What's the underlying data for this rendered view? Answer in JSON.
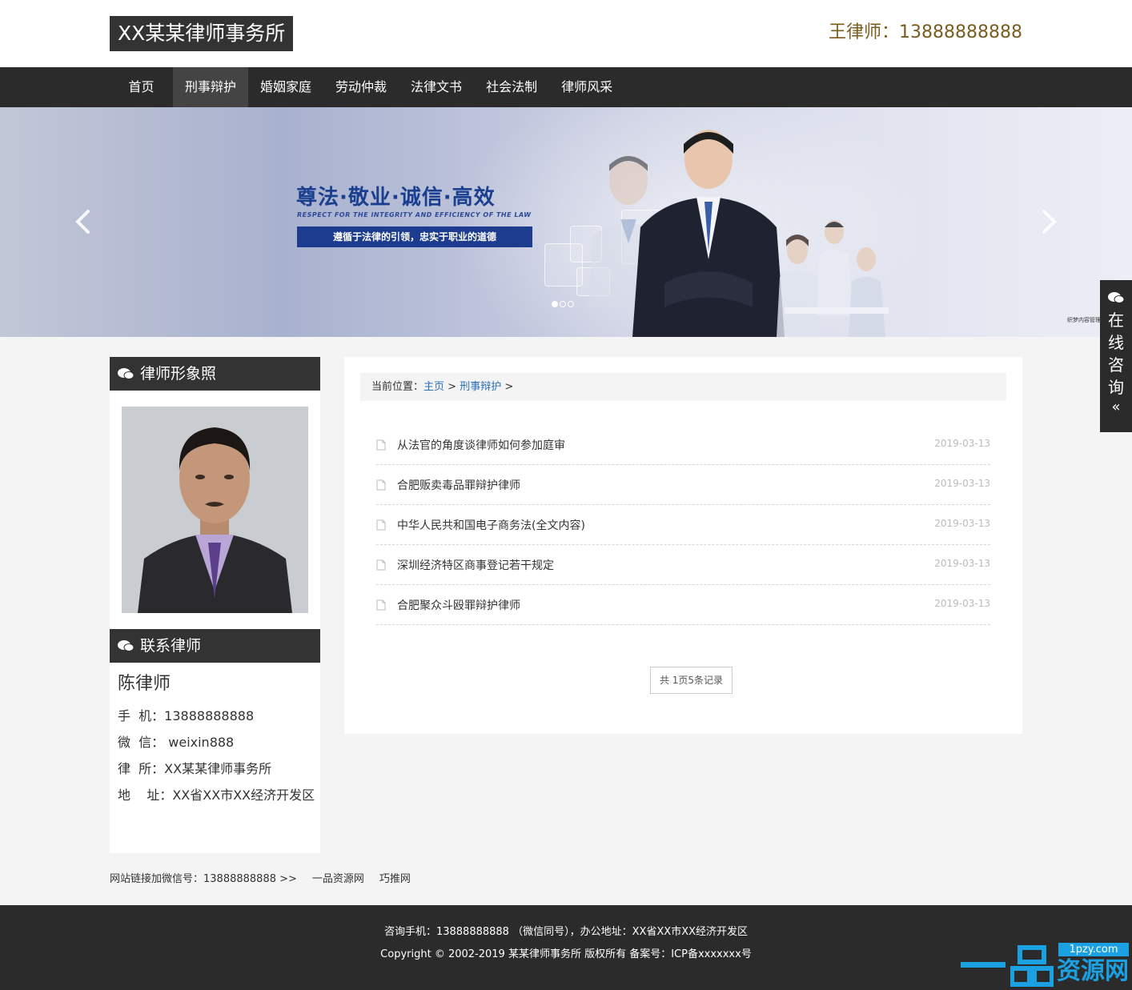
{
  "header": {
    "logo": "XX某某律师事务所",
    "hotline": "王律师：13888888888"
  },
  "nav": {
    "items": [
      "首页",
      "刑事辩护",
      "婚姻家庭",
      "劳动仲裁",
      "法律文书",
      "社会法制",
      "律师风采"
    ],
    "active_index": 1
  },
  "banner": {
    "slogan": "尊法·敬业·诚信·高效",
    "slogan_en": "RESPECT FOR THE INTEGRITY AND EFFICIENCY OF THE LAW",
    "slogan_bar": "遵循于法律的引领，忠实于职业的道德",
    "prev_icon": "‹",
    "next_icon": "›",
    "slide_count": 3,
    "active_slide": 1,
    "corner_text": "织梦内容管理 DEDECMS"
  },
  "consult": {
    "label": "在线咨询",
    "chevron": "«"
  },
  "sidebar": {
    "photo_title": "律师形象照",
    "contact_title": "联系律师",
    "name": "陈律师",
    "phone": "手  机：13888888888",
    "wechat": "微  信： weixin888",
    "firm": "律  所：XX某某律师事务所",
    "address": "地    址：XX省XX市XX经济开发区"
  },
  "main": {
    "crumb_prefix": "当前位置：",
    "crumb_home": "主页",
    "crumb_sep": ">",
    "crumb_cat": "刑事辩护",
    "crumb_end": ">",
    "articles": [
      {
        "title": "从法官的角度谈律师如何参加庭审",
        "date": "2019-03-13"
      },
      {
        "title": "合肥贩卖毒品罪辩护律师",
        "date": "2019-03-13"
      },
      {
        "title": "中华人民共和国电子商务法(全文内容)",
        "date": "2019-03-13"
      },
      {
        "title": "深圳经济特区商事登记若干规定",
        "date": "2019-03-13"
      },
      {
        "title": "合肥聚众斗殴罪辩护律师",
        "date": "2019-03-13"
      }
    ],
    "pager": "共 1页5条记录"
  },
  "links": {
    "label": "网站链接加微信号：13888888888 >>",
    "items": [
      "一品资源网",
      "巧推网"
    ]
  },
  "footer": {
    "line1": "咨询手机：13888888888 （微信同号），办公地址：XX省XX市XX经济开发区",
    "line2": "Copyright © 2002-2019 某某律师事务所 版权所有 备案号：ICP备xxxxxxx号"
  },
  "watermark": {
    "url": "1pzy.com",
    "name": "资源网"
  }
}
